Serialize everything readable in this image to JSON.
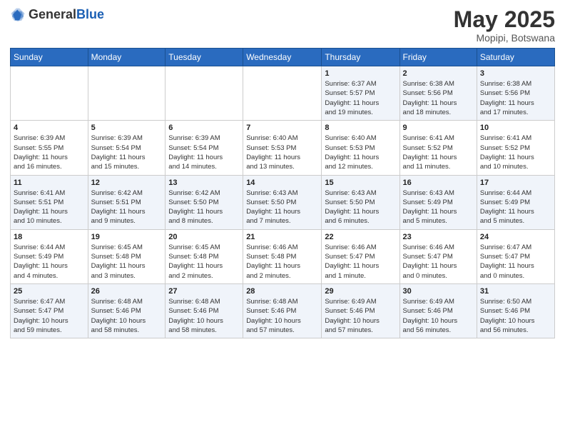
{
  "header": {
    "logo_general": "General",
    "logo_blue": "Blue",
    "title": "May 2025",
    "location": "Mopipi, Botswana"
  },
  "weekdays": [
    "Sunday",
    "Monday",
    "Tuesday",
    "Wednesday",
    "Thursday",
    "Friday",
    "Saturday"
  ],
  "weeks": [
    [
      {
        "day": "",
        "detail": ""
      },
      {
        "day": "",
        "detail": ""
      },
      {
        "day": "",
        "detail": ""
      },
      {
        "day": "",
        "detail": ""
      },
      {
        "day": "1",
        "detail": "Sunrise: 6:37 AM\nSunset: 5:57 PM\nDaylight: 11 hours\nand 19 minutes."
      },
      {
        "day": "2",
        "detail": "Sunrise: 6:38 AM\nSunset: 5:56 PM\nDaylight: 11 hours\nand 18 minutes."
      },
      {
        "day": "3",
        "detail": "Sunrise: 6:38 AM\nSunset: 5:56 PM\nDaylight: 11 hours\nand 17 minutes."
      }
    ],
    [
      {
        "day": "4",
        "detail": "Sunrise: 6:39 AM\nSunset: 5:55 PM\nDaylight: 11 hours\nand 16 minutes."
      },
      {
        "day": "5",
        "detail": "Sunrise: 6:39 AM\nSunset: 5:54 PM\nDaylight: 11 hours\nand 15 minutes."
      },
      {
        "day": "6",
        "detail": "Sunrise: 6:39 AM\nSunset: 5:54 PM\nDaylight: 11 hours\nand 14 minutes."
      },
      {
        "day": "7",
        "detail": "Sunrise: 6:40 AM\nSunset: 5:53 PM\nDaylight: 11 hours\nand 13 minutes."
      },
      {
        "day": "8",
        "detail": "Sunrise: 6:40 AM\nSunset: 5:53 PM\nDaylight: 11 hours\nand 12 minutes."
      },
      {
        "day": "9",
        "detail": "Sunrise: 6:41 AM\nSunset: 5:52 PM\nDaylight: 11 hours\nand 11 minutes."
      },
      {
        "day": "10",
        "detail": "Sunrise: 6:41 AM\nSunset: 5:52 PM\nDaylight: 11 hours\nand 10 minutes."
      }
    ],
    [
      {
        "day": "11",
        "detail": "Sunrise: 6:41 AM\nSunset: 5:51 PM\nDaylight: 11 hours\nand 10 minutes."
      },
      {
        "day": "12",
        "detail": "Sunrise: 6:42 AM\nSunset: 5:51 PM\nDaylight: 11 hours\nand 9 minutes."
      },
      {
        "day": "13",
        "detail": "Sunrise: 6:42 AM\nSunset: 5:50 PM\nDaylight: 11 hours\nand 8 minutes."
      },
      {
        "day": "14",
        "detail": "Sunrise: 6:43 AM\nSunset: 5:50 PM\nDaylight: 11 hours\nand 7 minutes."
      },
      {
        "day": "15",
        "detail": "Sunrise: 6:43 AM\nSunset: 5:50 PM\nDaylight: 11 hours\nand 6 minutes."
      },
      {
        "day": "16",
        "detail": "Sunrise: 6:43 AM\nSunset: 5:49 PM\nDaylight: 11 hours\nand 5 minutes."
      },
      {
        "day": "17",
        "detail": "Sunrise: 6:44 AM\nSunset: 5:49 PM\nDaylight: 11 hours\nand 5 minutes."
      }
    ],
    [
      {
        "day": "18",
        "detail": "Sunrise: 6:44 AM\nSunset: 5:49 PM\nDaylight: 11 hours\nand 4 minutes."
      },
      {
        "day": "19",
        "detail": "Sunrise: 6:45 AM\nSunset: 5:48 PM\nDaylight: 11 hours\nand 3 minutes."
      },
      {
        "day": "20",
        "detail": "Sunrise: 6:45 AM\nSunset: 5:48 PM\nDaylight: 11 hours\nand 2 minutes."
      },
      {
        "day": "21",
        "detail": "Sunrise: 6:46 AM\nSunset: 5:48 PM\nDaylight: 11 hours\nand 2 minutes."
      },
      {
        "day": "22",
        "detail": "Sunrise: 6:46 AM\nSunset: 5:47 PM\nDaylight: 11 hours\nand 1 minute."
      },
      {
        "day": "23",
        "detail": "Sunrise: 6:46 AM\nSunset: 5:47 PM\nDaylight: 11 hours\nand 0 minutes."
      },
      {
        "day": "24",
        "detail": "Sunrise: 6:47 AM\nSunset: 5:47 PM\nDaylight: 11 hours\nand 0 minutes."
      }
    ],
    [
      {
        "day": "25",
        "detail": "Sunrise: 6:47 AM\nSunset: 5:47 PM\nDaylight: 10 hours\nand 59 minutes."
      },
      {
        "day": "26",
        "detail": "Sunrise: 6:48 AM\nSunset: 5:46 PM\nDaylight: 10 hours\nand 58 minutes."
      },
      {
        "day": "27",
        "detail": "Sunrise: 6:48 AM\nSunset: 5:46 PM\nDaylight: 10 hours\nand 58 minutes."
      },
      {
        "day": "28",
        "detail": "Sunrise: 6:48 AM\nSunset: 5:46 PM\nDaylight: 10 hours\nand 57 minutes."
      },
      {
        "day": "29",
        "detail": "Sunrise: 6:49 AM\nSunset: 5:46 PM\nDaylight: 10 hours\nand 57 minutes."
      },
      {
        "day": "30",
        "detail": "Sunrise: 6:49 AM\nSunset: 5:46 PM\nDaylight: 10 hours\nand 56 minutes."
      },
      {
        "day": "31",
        "detail": "Sunrise: 6:50 AM\nSunset: 5:46 PM\nDaylight: 10 hours\nand 56 minutes."
      }
    ]
  ]
}
